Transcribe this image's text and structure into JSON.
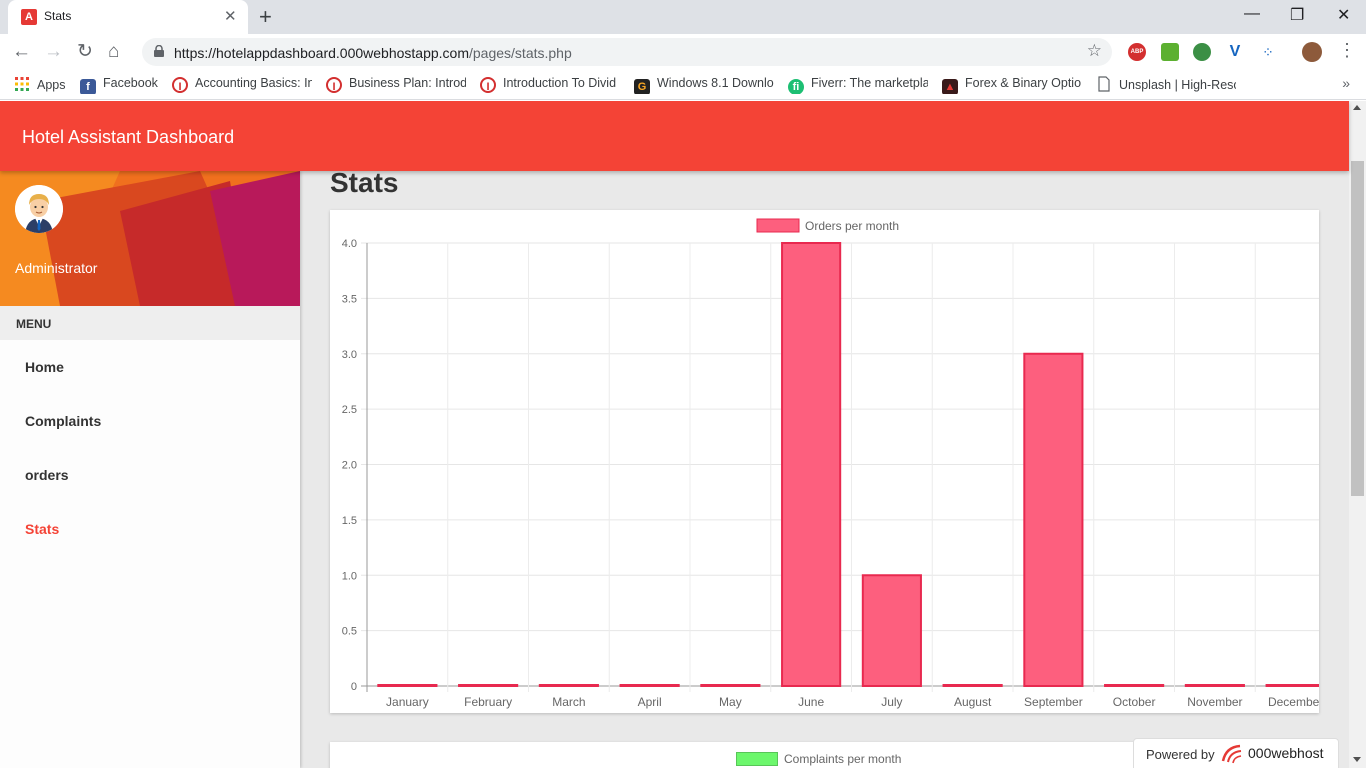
{
  "browser": {
    "tab_title": "Stats",
    "url_host": "https://hotelappdashboard.000webhostapp.com",
    "url_path": "/pages/stats.php",
    "bookmarks": [
      {
        "label": "Apps",
        "icon": "apps-grid-icon"
      },
      {
        "label": "Facebook",
        "icon": "facebook-icon"
      },
      {
        "label": "Accounting Basics: In",
        "icon": "udemy-icon"
      },
      {
        "label": "Business Plan: Introdu",
        "icon": "udemy-icon"
      },
      {
        "label": "Introduction To Divid",
        "icon": "udemy-icon"
      },
      {
        "label": "Windows 8.1 Downlo",
        "icon": "g-icon"
      },
      {
        "label": "Fiverr: The marketpla",
        "icon": "fiverr-icon"
      },
      {
        "label": "Forex & Binary Optio",
        "icon": "forex-icon"
      },
      {
        "label": "Unsplash | High-Reso",
        "icon": "page-icon"
      }
    ]
  },
  "app": {
    "title": "Hotel Assistant Dashboard",
    "user_name": "Administrator",
    "menu_header": "MENU",
    "menu": [
      {
        "label": "Home",
        "active": false
      },
      {
        "label": "Complaints",
        "active": false
      },
      {
        "label": "orders",
        "active": false
      },
      {
        "label": "Stats",
        "active": true
      }
    ],
    "page_title": "Stats",
    "second_chart_legend": "Complaints per month",
    "powered_by": "Powered by",
    "powered_brand": "000webhost"
  },
  "colors": {
    "navbar": "#f44336",
    "bar_fill": "#fd5f7e",
    "bar_border": "#e8294f",
    "complaints_swatch": "#6cf76c"
  },
  "chart_data": {
    "type": "bar",
    "categories": [
      "January",
      "February",
      "March",
      "April",
      "May",
      "June",
      "July",
      "August",
      "September",
      "October",
      "November",
      "December"
    ],
    "series": [
      {
        "name": "Orders per month",
        "values": [
          0,
          0,
          0,
          0,
          0,
          4,
          1,
          0,
          3,
          0,
          0,
          0
        ]
      }
    ],
    "yticks": [
      "0",
      "0.5",
      "1.0",
      "1.5",
      "2.0",
      "2.5",
      "3.0",
      "3.5",
      "4.0"
    ],
    "ylim": [
      0,
      4
    ],
    "grid": true,
    "legend_position": "top"
  }
}
